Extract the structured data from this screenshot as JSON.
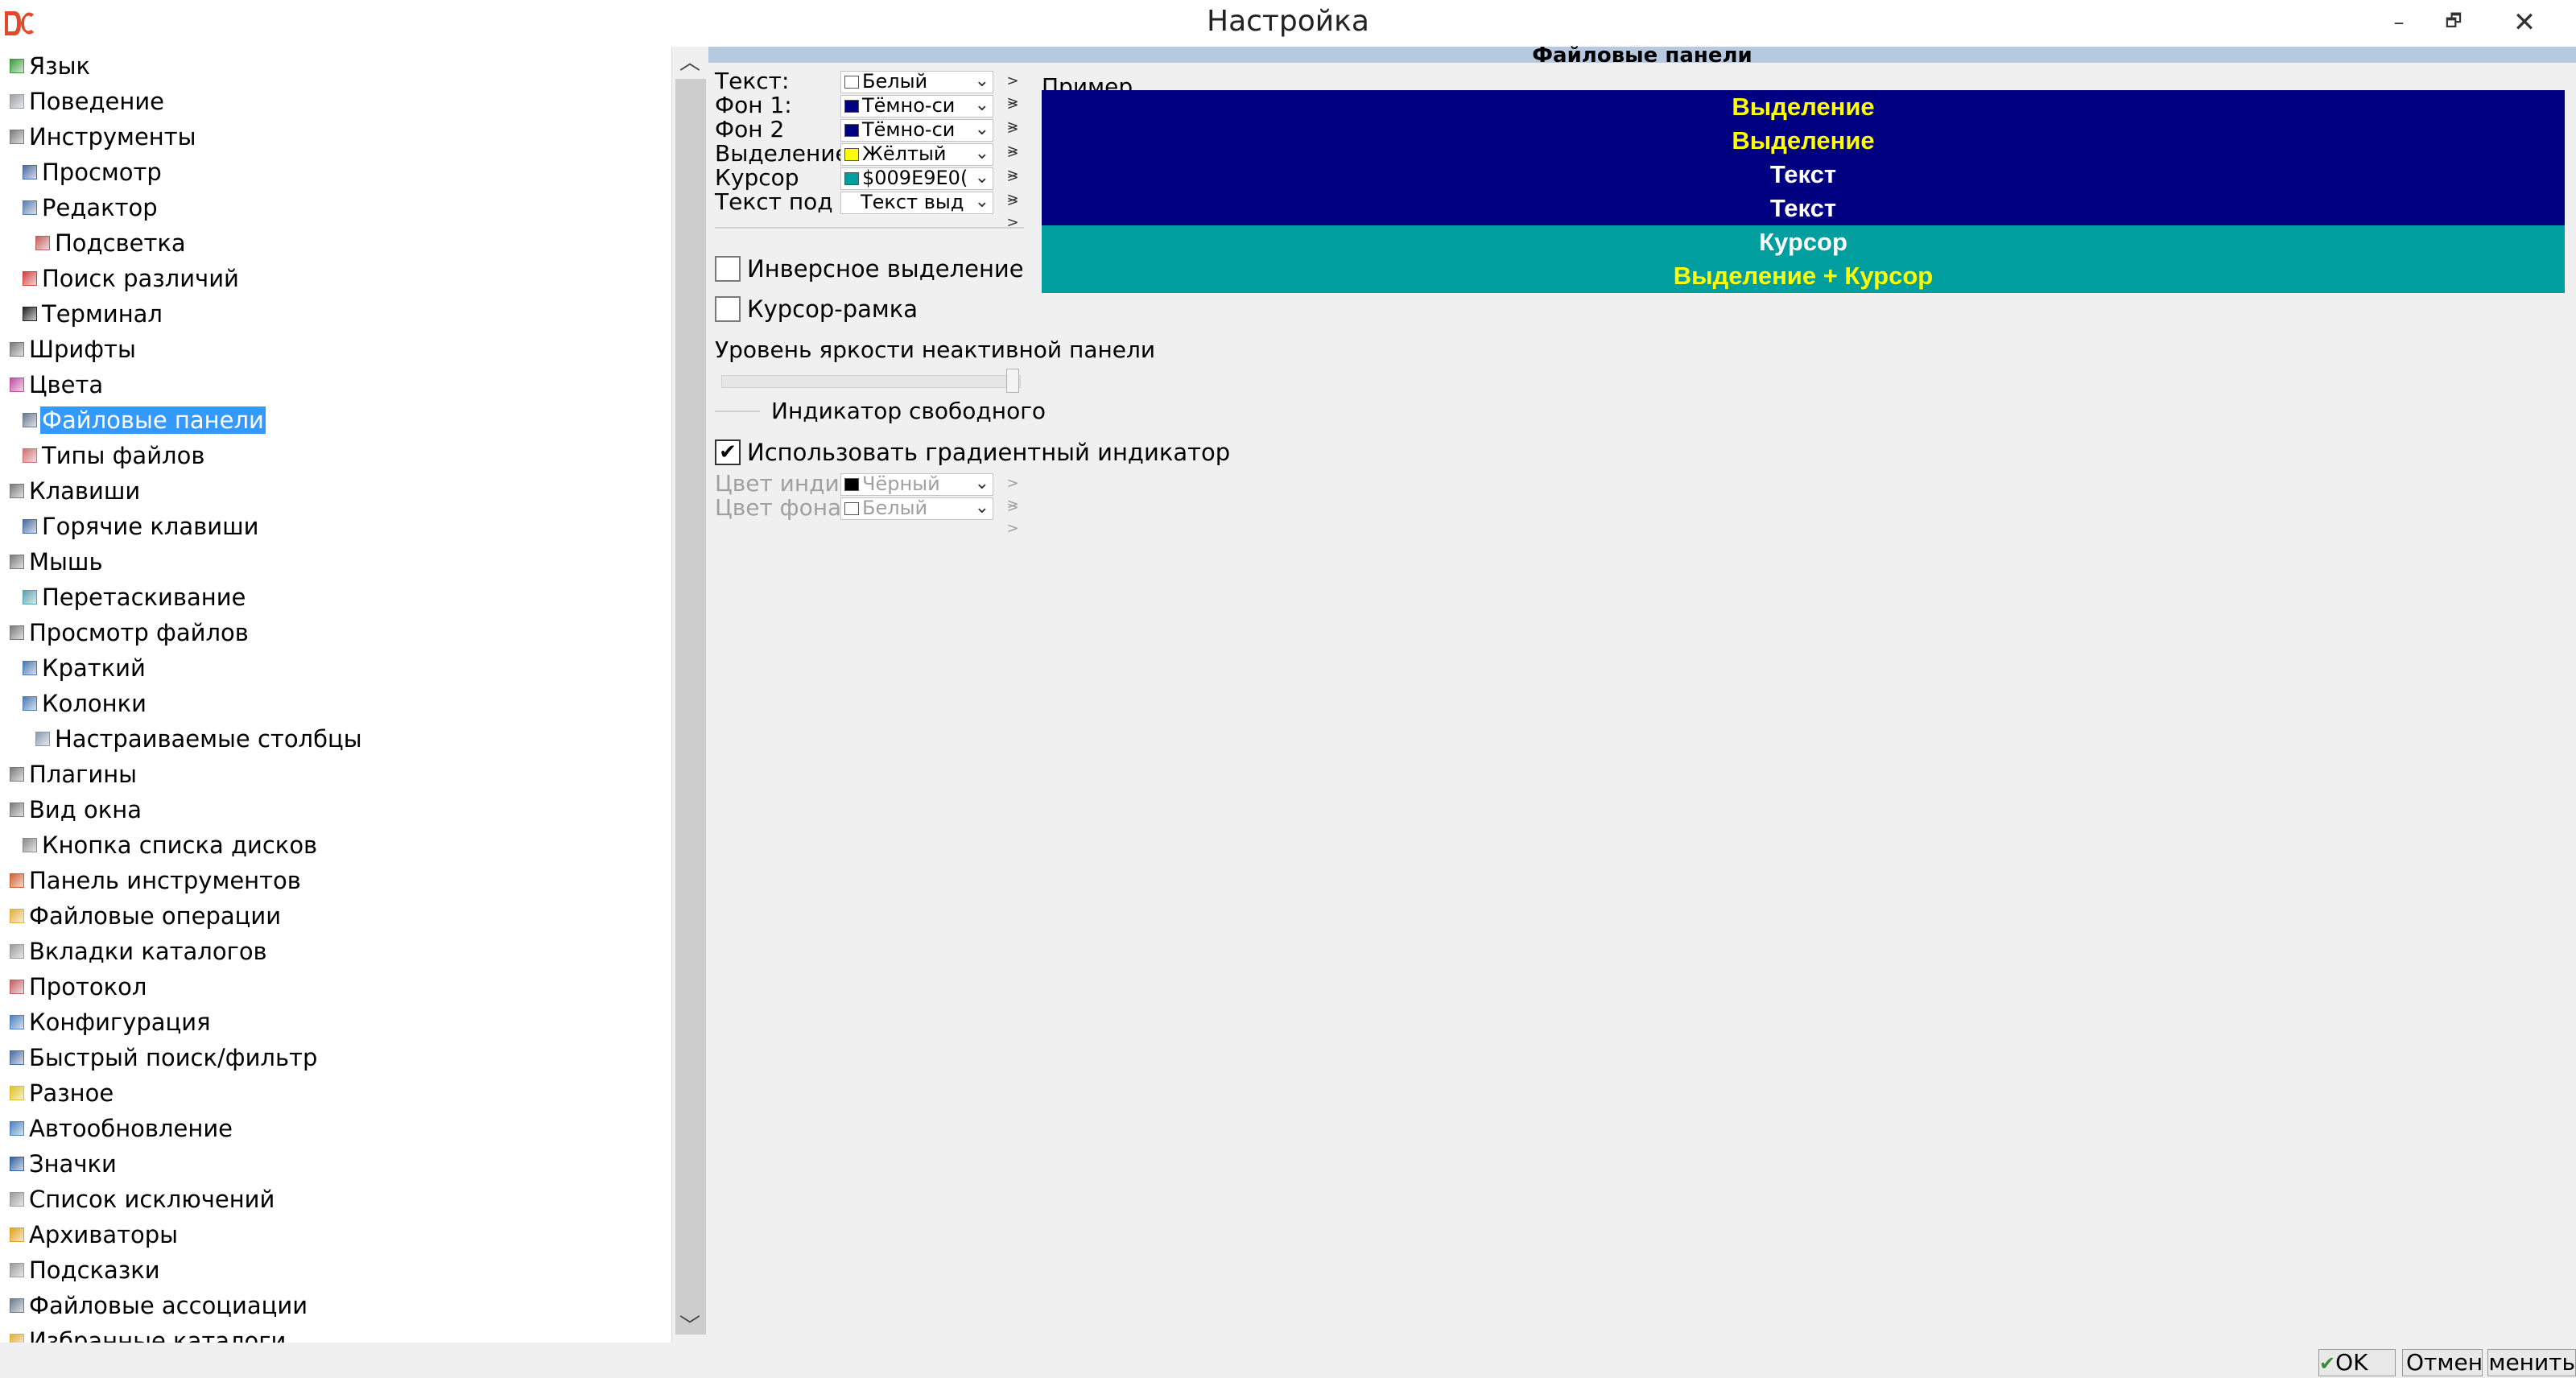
{
  "window": {
    "title": "Настройка",
    "minimize_glyph": "–",
    "restore_glyph": "🗗",
    "close_glyph": "✕"
  },
  "tree": {
    "items": [
      {
        "label": "Язык",
        "level": 0,
        "icon": "language-icon",
        "color": "#3c9a3c"
      },
      {
        "label": "Поведение",
        "level": 0,
        "icon": "behavior-icon",
        "color": "#9aa0a6"
      },
      {
        "label": "Инструменты",
        "level": 0,
        "icon": "tools-icon",
        "color": "#7a7a7a"
      },
      {
        "label": "Просмотр",
        "level": 1,
        "icon": "viewer-icon",
        "color": "#4a6aa0"
      },
      {
        "label": "Редактор",
        "level": 1,
        "icon": "editor-icon",
        "color": "#5b7db0"
      },
      {
        "label": "Подсветка",
        "level": 2,
        "icon": "highlight-icon",
        "color": "#c06060"
      },
      {
        "label": "Поиск различий",
        "level": 1,
        "icon": "diff-icon",
        "color": "#d04040"
      },
      {
        "label": "Терминал",
        "level": 1,
        "icon": "terminal-icon",
        "color": "#222222"
      },
      {
        "label": "Шрифты",
        "level": 0,
        "icon": "fonts-icon",
        "color": "#7a7a7a"
      },
      {
        "label": "Цвета",
        "level": 0,
        "icon": "colors-icon",
        "color": "#c04fa0"
      },
      {
        "label": "Файловые панели",
        "level": 1,
        "icon": "file-panels-icon",
        "color": "#6a7a90",
        "selected": true
      },
      {
        "label": "Типы файлов",
        "level": 1,
        "icon": "file-types-icon",
        "color": "#d07070"
      },
      {
        "label": "Клавиши",
        "level": 0,
        "icon": "keys-icon",
        "color": "#7a7a7a"
      },
      {
        "label": "Горячие клавиши",
        "level": 1,
        "icon": "hotkeys-icon",
        "color": "#4a6aa0"
      },
      {
        "label": "Мышь",
        "level": 0,
        "icon": "mouse-icon",
        "color": "#7a7a7a"
      },
      {
        "label": "Перетаскивание",
        "level": 1,
        "icon": "drag-drop-icon",
        "color": "#5aa0b0"
      },
      {
        "label": "Просмотр файлов",
        "level": 0,
        "icon": "file-view-icon",
        "color": "#7a7a7a"
      },
      {
        "label": "Краткий",
        "level": 1,
        "icon": "brief-view-icon",
        "color": "#4a7ab0"
      },
      {
        "label": "Колонки",
        "level": 1,
        "icon": "columns-icon",
        "color": "#4a7ab0"
      },
      {
        "label": "Настраиваемые столбцы",
        "level": 2,
        "icon": "custom-columns-icon",
        "color": "#8a9ab0"
      },
      {
        "label": "Плагины",
        "level": 0,
        "icon": "plugins-icon",
        "color": "#7a7a7a"
      },
      {
        "label": "Вид окна",
        "level": 0,
        "icon": "window-layout-icon",
        "color": "#7a7a7a"
      },
      {
        "label": "Кнопка списка дисков",
        "level": 1,
        "icon": "drive-list-icon",
        "color": "#8a8a8a"
      },
      {
        "label": "Панель инструментов",
        "level": 0,
        "icon": "toolbar-icon",
        "color": "#d06030"
      },
      {
        "label": "Файловые операции",
        "level": 0,
        "icon": "file-operations-icon",
        "color": "#e0b040"
      },
      {
        "label": "Вкладки каталогов",
        "level": 0,
        "icon": "folder-tabs-icon",
        "color": "#9a9a9a"
      },
      {
        "label": "Протокол",
        "level": 0,
        "icon": "log-icon",
        "color": "#c06060"
      },
      {
        "label": "Конфигурация",
        "level": 0,
        "icon": "configuration-icon",
        "color": "#4a80c0"
      },
      {
        "label": "Быстрый поиск/фильтр",
        "level": 0,
        "icon": "quick-search-icon",
        "color": "#4a6aa0"
      },
      {
        "label": "Разное",
        "level": 0,
        "icon": "misc-icon",
        "color": "#e0c020"
      },
      {
        "label": "Автообновление",
        "level": 0,
        "icon": "auto-refresh-icon",
        "color": "#4a80c0"
      },
      {
        "label": "Значки",
        "level": 0,
        "icon": "icons-icon",
        "color": "#3060a0"
      },
      {
        "label": "Список исключений",
        "level": 0,
        "icon": "ignore-list-icon",
        "color": "#9a9a9a"
      },
      {
        "label": "Архиваторы",
        "level": 0,
        "icon": "archivers-icon",
        "color": "#e0a020"
      },
      {
        "label": "Подсказки",
        "level": 0,
        "icon": "tooltips-icon",
        "color": "#9a9a9a"
      },
      {
        "label": "Файловые ассоциации",
        "level": 0,
        "icon": "file-associations-icon",
        "color": "#6a7a8a"
      },
      {
        "label": "Избранные каталоги",
        "level": 0,
        "icon": "favorite-folders-icon",
        "color": "#e0b040"
      }
    ]
  },
  "panel": {
    "header": "Файловые панели",
    "colors": [
      {
        "label": "Текст:",
        "value": "Белый",
        "swatch": "#ffffff"
      },
      {
        "label": "Фон 1:",
        "value": "Тёмно-си",
        "swatch": "#000080"
      },
      {
        "label": "Фон 2",
        "value": "Тёмно-си",
        "swatch": "#000080"
      },
      {
        "label": "Выделение",
        "value": "Жёлтый",
        "swatch": "#ffff00"
      },
      {
        "label": "Курсор",
        "value": "$009E9E0(",
        "swatch": "#009e9e"
      },
      {
        "label": "Текст под курсором",
        "value": "Текст выд",
        "swatch": null
      }
    ],
    "more_glyph": "> >",
    "inverse_selection": {
      "label": "Инверсное выделение",
      "checked": false
    },
    "frame_cursor": {
      "label": "Курсор-рамка",
      "checked": false
    },
    "brightness": {
      "label": "Уровень яркости неактивной панели",
      "value_percent": 100
    },
    "free_space_group": "Индикатор свободного",
    "gradient": {
      "label": "Использовать градиентный индикатор",
      "checked": true,
      "check_glyph": "✔"
    },
    "indicator_color": {
      "label": "Цвет индикатора",
      "value": "Чёрный",
      "swatch": "#000000"
    },
    "indicator_bg": {
      "label": "Цвет фона индикатора",
      "value": "Белый",
      "swatch": "#ffffff"
    }
  },
  "preview": {
    "label": "Пример",
    "rows": [
      {
        "text": "Выделение",
        "fg": "#ffff00",
        "bg": "#000080"
      },
      {
        "text": "Выделение",
        "fg": "#ffff00",
        "bg": "#000080"
      },
      {
        "text": "Текст",
        "fg": "#ffffff",
        "bg": "#000080"
      },
      {
        "text": "Текст",
        "fg": "#ffffff",
        "bg": "#000080"
      },
      {
        "text": "Курсор",
        "fg": "#ffffff",
        "bg": "#009e9e"
      },
      {
        "text": "Выделение + Курсор",
        "fg": "#ffff00",
        "bg": "#009e9e"
      }
    ]
  },
  "buttons": {
    "ok": "OK",
    "ok_glyph": "✔",
    "cancel": "Отмена",
    "apply": "Применить"
  }
}
